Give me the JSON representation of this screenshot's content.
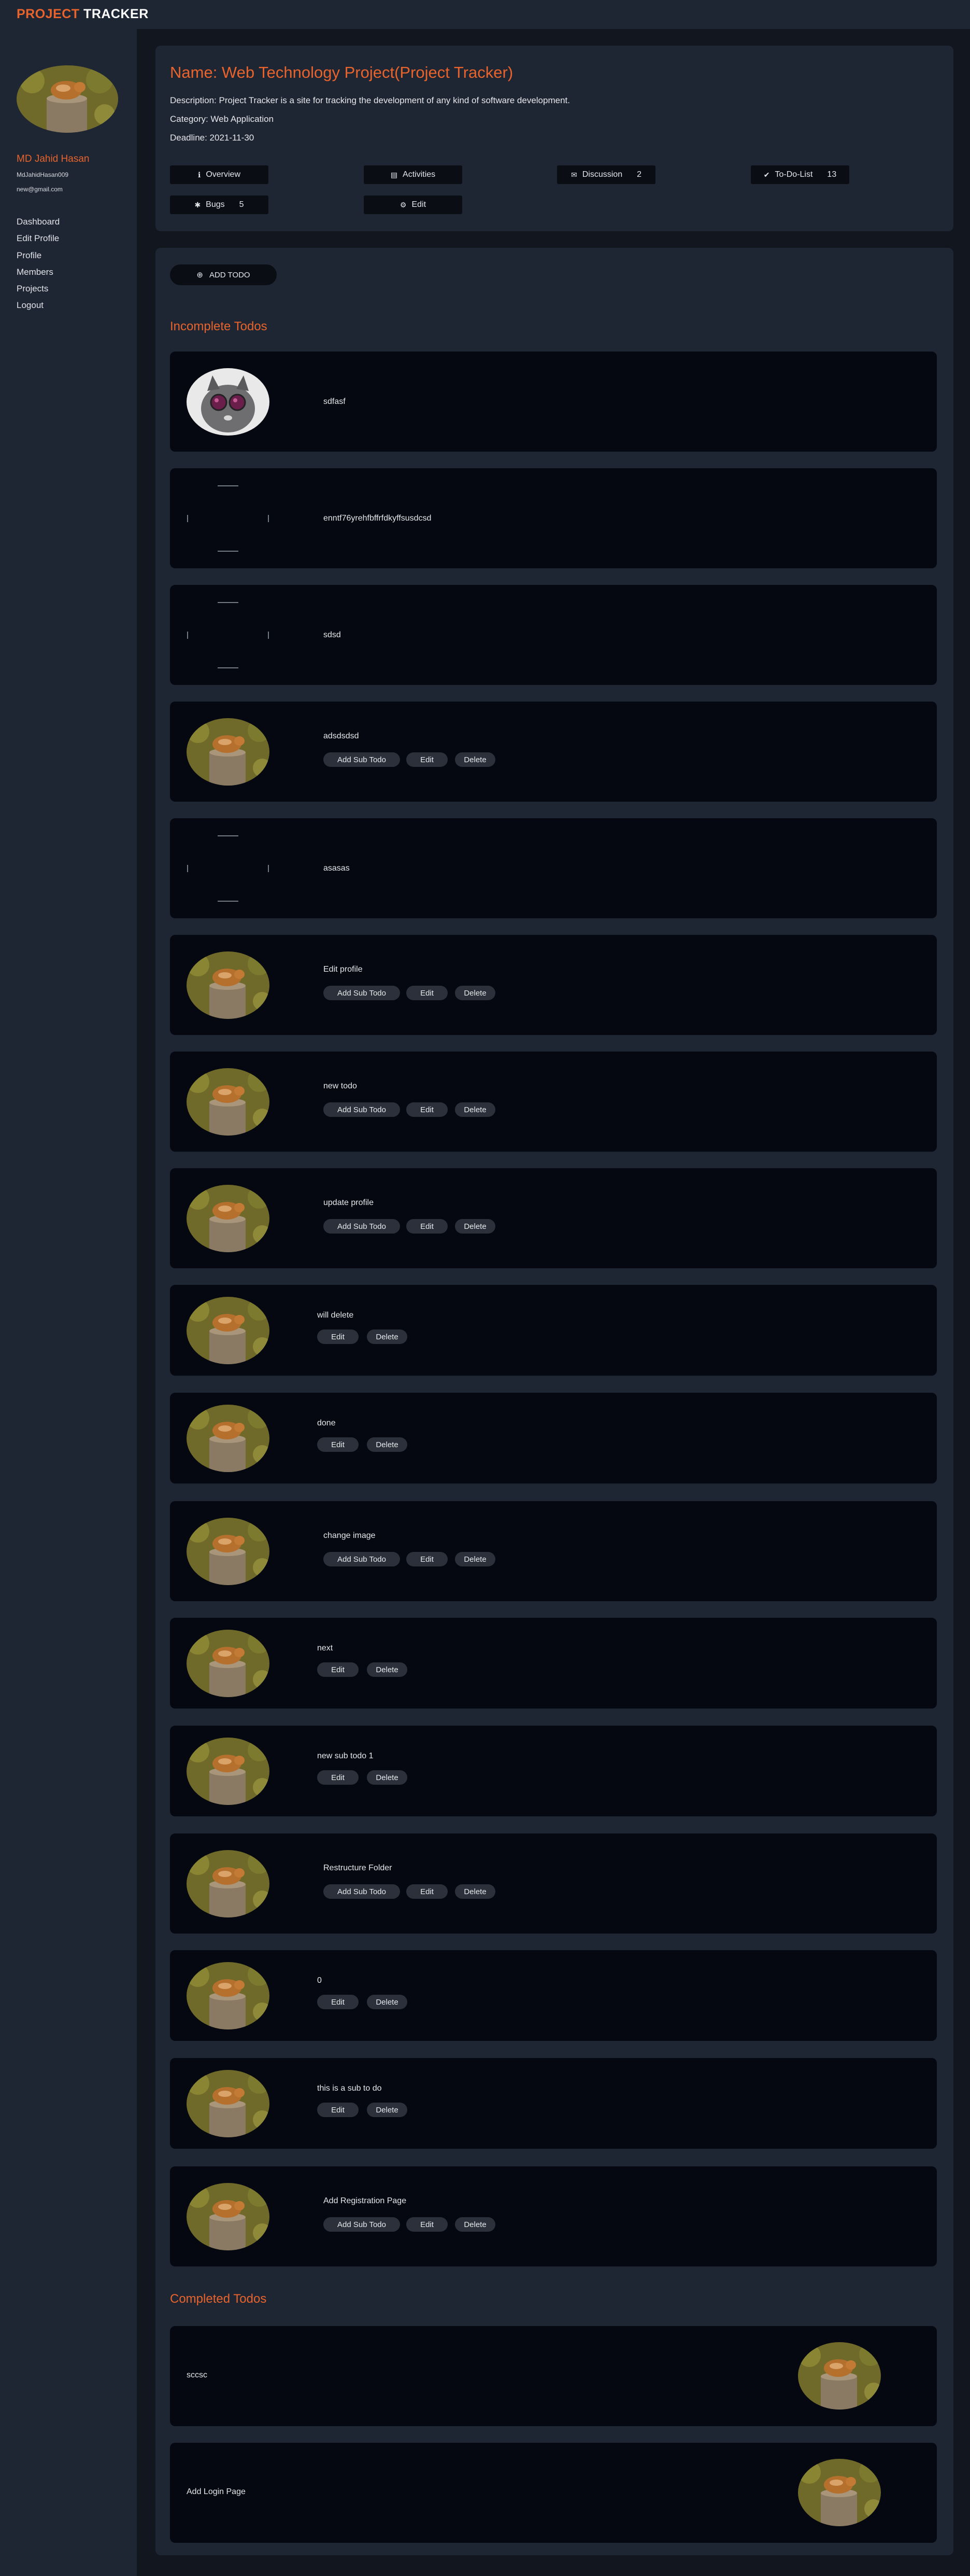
{
  "brand": {
    "accent": "PROJECT",
    "rest": "TRACKER"
  },
  "user": {
    "name": "MD Jahid Hasan",
    "handle": "MdJahidHasan009",
    "email": "new@gmail.com"
  },
  "nav": [
    {
      "label": "Dashboard"
    },
    {
      "label": "Edit Profile"
    },
    {
      "label": "Profile"
    },
    {
      "label": "Members"
    },
    {
      "label": "Projects"
    },
    {
      "label": "Logout"
    }
  ],
  "project": {
    "name": "Name: Web Technology Project(Project Tracker)",
    "description": "Description: Project Tracker is a site for tracking the development of any kind of software development.",
    "category": "Category: Web Application",
    "deadline": "Deadline: 2021-11-30"
  },
  "tabs": {
    "overview": {
      "label": "Overview",
      "icon": "info-icon"
    },
    "activities": {
      "label": "Activities",
      "icon": "clipboard-icon"
    },
    "discussion": {
      "label": "Discussion",
      "count": "2",
      "icon": "comments-icon"
    },
    "todo": {
      "label": "To-Do-List",
      "count": "13",
      "icon": "check-circle-icon"
    },
    "bugs": {
      "label": "Bugs",
      "count": "5",
      "icon": "bug-icon"
    },
    "edit": {
      "label": "Edit",
      "icon": "gear-icon"
    }
  },
  "add_todo": {
    "label": "ADD TODO",
    "icon": "plus-circle-icon"
  },
  "buttons": {
    "add_sub": "Add Sub Todo",
    "edit": "Edit",
    "delete": "Delete"
  },
  "sections": {
    "incomplete": "Incomplete Todos",
    "completed": "Completed Todos"
  },
  "incomplete_todos": [
    {
      "title": "sdfasf"
    },
    {
      "title": "enntf76yrehfbffrfdkyffsusdcsd"
    },
    {
      "title": "sdsd"
    },
    {
      "title": "adsdsdsd"
    },
    {
      "title": "asasas"
    },
    {
      "title": "Edit profile"
    },
    {
      "title": "new todo"
    },
    {
      "title": "update profile"
    },
    {
      "title": "will delete"
    },
    {
      "title": "done"
    },
    {
      "title": "change image"
    },
    {
      "title": "next"
    },
    {
      "title": "new sub todo 1"
    },
    {
      "title": "Restructure Folder"
    },
    {
      "title": "0"
    },
    {
      "title": "this is a sub to do"
    },
    {
      "title": "Add Registration Page"
    }
  ],
  "completed_todos": [
    {
      "title": "sccsc"
    },
    {
      "title": "Add Login Page"
    }
  ],
  "colors": {
    "accent": "#e8642c",
    "sidebar": "#1e2533",
    "main": "#11161f",
    "card": "#050810",
    "pill": "#2b303b"
  }
}
